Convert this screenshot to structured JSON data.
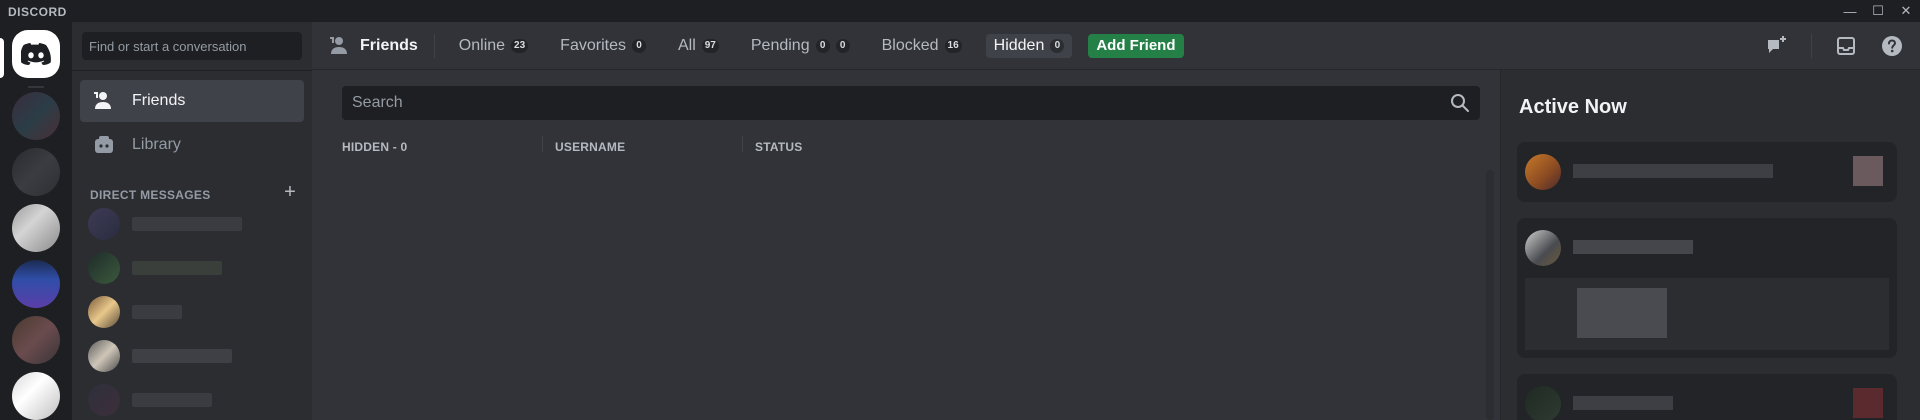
{
  "app": {
    "brand": "DISCORD"
  },
  "window_controls": {
    "minimize": "—",
    "maximize": "☐",
    "close": "✕"
  },
  "dm_sidebar": {
    "search_placeholder": "Find or start a conversation",
    "nav": [
      {
        "label": "Friends",
        "icon": "friends-icon",
        "active": true
      },
      {
        "label": "Library",
        "icon": "library-icon",
        "active": false
      }
    ],
    "direct_messages_header": "DIRECT MESSAGES",
    "add_dm_label": "+"
  },
  "topbar": {
    "title": "Friends",
    "tabs": [
      {
        "label": "Online",
        "badges": [
          "23"
        ],
        "active": false
      },
      {
        "label": "Favorites",
        "badges": [
          "0"
        ],
        "active": false
      },
      {
        "label": "All",
        "badges": [
          "97"
        ],
        "active": false
      },
      {
        "label": "Pending",
        "badges": [
          "0",
          "0"
        ],
        "active": false
      },
      {
        "label": "Blocked",
        "badges": [
          "16"
        ],
        "active": false
      },
      {
        "label": "Hidden",
        "badges": [
          "0"
        ],
        "active": true
      }
    ],
    "add_friend_label": "Add Friend"
  },
  "friends_list": {
    "search_placeholder": "Search",
    "columns": [
      "HIDDEN - 0",
      "USERNAME",
      "STATUS"
    ]
  },
  "active_now": {
    "title": "Active Now"
  },
  "colors": {
    "accent_green": "#248046",
    "background": "#313338",
    "sidebar": "#2b2d31",
    "server_rail": "#1e1f22"
  }
}
